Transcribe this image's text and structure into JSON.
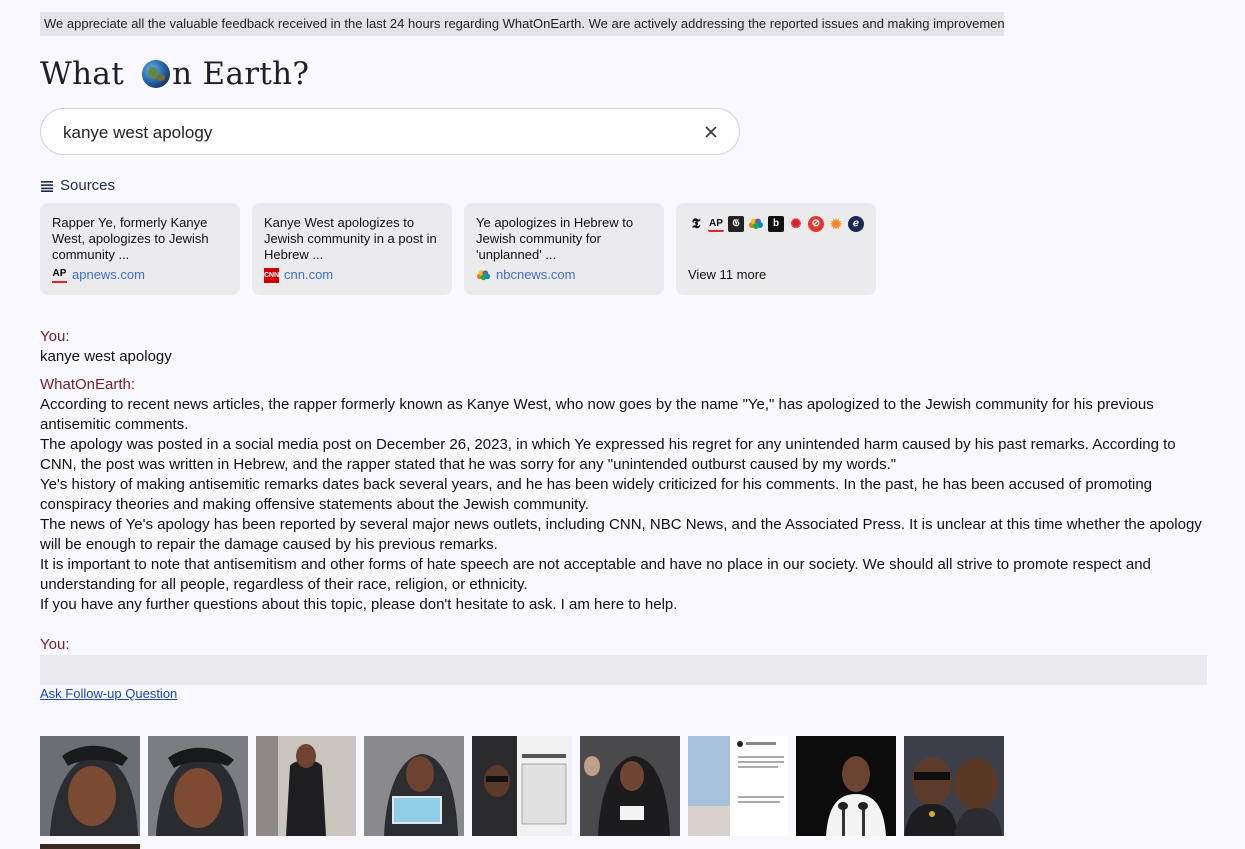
{
  "banner": "We appreciate all the valuable feedback received in the last 24 hours regarding WhatOnEarth. We are actively addressing the reported issues and making improvements.",
  "logo": {
    "part1": "What ",
    "part2": "n Earth?"
  },
  "search": {
    "value": "kanye west apology"
  },
  "sources": {
    "heading": "Sources",
    "cards": [
      {
        "title": "Rapper Ye, formerly Kanye West, apologizes to Jewish community ...",
        "domain": "apnews.com",
        "icon": "ap-icon"
      },
      {
        "title": "Kanye West apologizes to Jewish community in a post in Hebrew ...",
        "domain": "cnn.com",
        "icon": "cnn-icon"
      },
      {
        "title": "Ye apologizes in Hebrew to Jewish community for 'unplanned' ...",
        "domain": "nbcnews.com",
        "icon": "nbc-icon"
      }
    ],
    "more_label": "View 11 more"
  },
  "chat": {
    "user_label": "You:",
    "user_query": "kanye west apology",
    "bot_label": "WhatOnEarth:",
    "paragraphs": [
      "According to recent news articles, the rapper formerly known as Kanye West, who now goes by the name \"Ye,\" has apologized to the Jewish community for his previous antisemitic comments.",
      "The apology was posted in a social media post on December 26, 2023, in which Ye expressed his regret for any unintended harm caused by his past remarks. According to CNN, the post was written in Hebrew, and the rapper stated that he was sorry for any \"unintended outburst caused by my words.\"",
      "Ye's history of making antisemitic remarks dates back several years, and he has been widely criticized for his comments. In the past, he has been accused of promoting conspiracy theories and making offensive statements about the Jewish community.",
      "The news of Ye's apology has been reported by several major news outlets, including CNN, NBC News, and the Associated Press. It is unclear at this time whether the apology will be enough to repair the damage caused by his previous remarks.",
      "It is important to note that antisemitism and other forms of hate speech are not acceptable and have no place in our society. We should all strive to promote respect and understanding for all people, regardless of their race, religion, or ethnicity.",
      "If you have any further questions about this topic, please don't hesitate to ask. I am here to help."
    ],
    "followup_label": "You:",
    "ask_link": "Ask Follow-up Question"
  },
  "colors": {
    "background": "#f8f8fe",
    "role_label": "#7a1f1f",
    "link": "#1a45c4",
    "card_bg": "#ebebee"
  }
}
